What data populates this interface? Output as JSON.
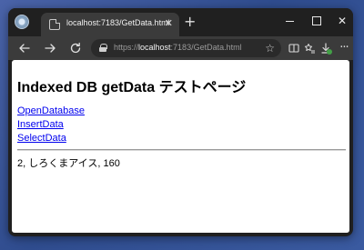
{
  "browser": {
    "tab_title": "localhost:7183/GetData.html",
    "tab_close_glyph": "✕",
    "new_tab_glyph": "+",
    "window_close_glyph": "✕",
    "address": {
      "scheme": "https://",
      "host": "localhost",
      "path": ":7183/GetData.html"
    },
    "icons": {
      "back": "arrow-left-icon",
      "forward": "arrow-right-icon",
      "refresh": "refresh-icon",
      "lock": "lock-icon",
      "star": "star-icon",
      "split": "split-screen-icon",
      "favorites": "favorites-icon",
      "downloads": "download-icon",
      "more": "more-icon"
    }
  },
  "page": {
    "title": "Indexed DB getData テストページ",
    "links": {
      "open": "OpenDatabase",
      "insert": "InsertData",
      "select": "SelectData"
    },
    "result": "2, しろくまアイス, 160"
  },
  "colors": {
    "link": "#0000ee",
    "chrome_dark": "#202020",
    "toolbar": "#3b3b3b",
    "download_badge": "#43a047"
  }
}
